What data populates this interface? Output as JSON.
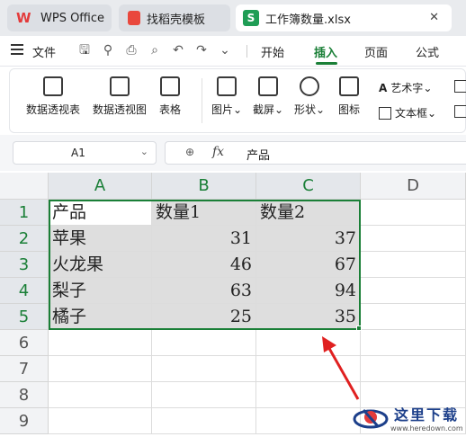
{
  "tabs": [
    {
      "label": "WPS Office",
      "icon": "wps-logo-icon"
    },
    {
      "label": "找稻壳模板",
      "icon": "docer-icon"
    },
    {
      "label": "工作簿数量.xlsx",
      "icon": "spreadsheet-s-icon",
      "active": true
    }
  ],
  "menubar": {
    "file_label": "文件",
    "tabs": [
      "开始",
      "插入",
      "页面",
      "公式"
    ],
    "active_tab": "插入"
  },
  "ribbon": {
    "pivot_table": "数据透视表",
    "pivot_chart": "数据透视图",
    "table": "表格",
    "picture": "图片",
    "screenshot": "截屏",
    "shape": "形状",
    "icon": "图标",
    "wordart": "艺术字",
    "textbox": "文本框"
  },
  "formula_bar": {
    "name_box": "A1",
    "fx_label": "fx",
    "content": "产品"
  },
  "grid": {
    "columns": [
      "A",
      "B",
      "C",
      "D"
    ],
    "rows": [
      "1",
      "2",
      "3",
      "4",
      "5",
      "6",
      "7",
      "8",
      "9"
    ],
    "cells": [
      [
        "产品",
        "数量1",
        "数量2"
      ],
      [
        "苹果",
        "31",
        "37"
      ],
      [
        "火龙果",
        "46",
        "67"
      ],
      [
        "梨子",
        "63",
        "94"
      ],
      [
        "橘子",
        "25",
        "35"
      ]
    ],
    "selection": "A1:C5",
    "selection_color": "#1a7f37"
  },
  "watermark": {
    "title": "这里下载",
    "url": "www.heredown.com"
  }
}
